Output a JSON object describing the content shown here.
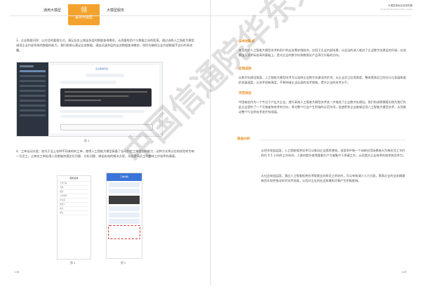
{
  "tabs": [
    {
      "label": "通用大模型"
    },
    {
      "label": "垂类大模型",
      "active": true,
      "icon": "领"
    },
    {
      "label": "大模型服务"
    }
  ],
  "header_right": {
    "title": "大模型落地应用案例集",
    "subtitle": "Large Model Application Cases"
  },
  "left_page": {
    "para1": "3、企业数据问答：以对话的要理方式，满足业务上频连多层的数据查询需求。从而暖呢用户与数据之间的距离。通过训练人工智能大模型调用企业内部系统的数据的能力，我们能够以满足业务数据，满连迅速多层的业务数据查询需求，同时在确保企业内部数据不会向外网进露。",
    "fig3_caption": "图 3",
    "fig3_chat_title": "企业数据问答",
    "para2": "4、工单自动分类：依托于业上各种不同来的的工单，使得人工智能大模型具备了自动判定工单类别的能力，这种方式将过往的经验转为每一位员工，让每名工单处理人员都能快速定位问题、分析问题、做出有效的解决方案，从而提高员工的整体工作效率和满意。",
    "fig4_caption": "图 4",
    "fig5_caption": "图 5",
    "phone4_title": "服务诉求",
    "phone4_items": [
      "工单分类",
      "问题",
      "描述",
      "工单类型",
      "紧急度",
      "处理人",
      "备注",
      "提交"
    ],
    "phone5_title": "工单详情"
  },
  "right_page": {
    "heading1": "技术创新点",
    "para_tech": "本案例将人工智能大模型技术和用户的业务需求相结合，应用于企业内部场景，以适当的流入推进了企业数字化建设的升级，在成都出及技术标准高的基础上，是对企业的数字化和数智化产品再引升级的方向。",
    "heading2": "应用成效",
    "para_effect": "从数字化建设角度，人工智能大模型技术可以加快企业数字化建设的步伐；从企业员工应用角度，整体提高员工的办公与发展和组织发展速度，从技术创新角度，不断突破企业自身的技术限制，提升企业的技术水平。",
    "heading3": "示范效应",
    "para_demo": "中国电信作为一个专注于产业大企业，提升高效人工智能大模型技术进一步推进了企业数字化建设。我们的成果需要实践为我们为此企业提供了一个可借鉴和参考的方向，将对整个行业产生积极的示范作用，促使更多企业能够运用人工智能大模型技术，从而推动整个行业的技术进步和发展。",
    "heading4": "效益分析",
    "para_benefit1": "从经济效益层面，人工智能相关技术可以推动企业提质增效，本案例中每一个创新应用场景每天为每名员工节约的约 0.5 小时的工作时间，人群的提升使得要素生产力被集中于关键工作，从而提升企业效率的效率和竞争力。",
    "para_benefit2": "从社会效益层面，通过人工智能相关技术赋能业务和员工的协作，可以有效减少人力方面，提高企业的业务精通新而实现并推动科学技术发展，从而对企业的社会和事和开事产生积极影响。"
  },
  "page_numbers": {
    "left": "146",
    "right": "146"
  },
  "watermark_text": "中国信通院华东分院",
  "colors": {
    "accent": "#f3a32d",
    "heading": "#e68a1c",
    "sidebar": "#2c3440"
  }
}
